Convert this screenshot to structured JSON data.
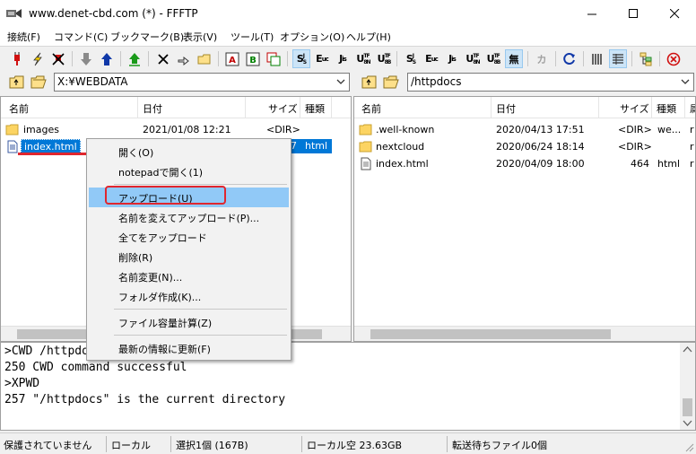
{
  "window": {
    "title": "www.denet-cbd.com (*) - FFFTP"
  },
  "menu": [
    "接続(F)",
    "コマンド(C)",
    "ブックマーク(B)",
    "表示(V)",
    "ツール(T)",
    "オプション(O)",
    "ヘルプ(H)"
  ],
  "toolbar": {
    "kanji_s": "S",
    "kanji_e": "E",
    "kanji_j": "J",
    "kanji_u": "U",
    "kanji_u8": "U",
    "nocvt": "無",
    "kana": "カ"
  },
  "local": {
    "path": "X:¥WEBDATA",
    "headers": {
      "name": "名前",
      "date": "日付",
      "size": "サイズ",
      "type": "種類"
    },
    "files": [
      {
        "name": "images",
        "date": "2021/01/08 12:21",
        "size": "<DIR>",
        "type": ""
      },
      {
        "name": "index.html",
        "date": "",
        "size": "7",
        "type": "html"
      }
    ]
  },
  "remote": {
    "path": "/httpdocs",
    "headers": {
      "name": "名前",
      "date": "日付",
      "size": "サイズ",
      "type": "種類",
      "perm": "属"
    },
    "files": [
      {
        "name": ".well-known",
        "date": "2020/04/13 17:51",
        "size": "<DIR>",
        "type": "we...",
        "perm": "r"
      },
      {
        "name": "nextcloud",
        "date": "2020/06/24 18:14",
        "size": "<DIR>",
        "type": "",
        "perm": "r"
      },
      {
        "name": "index.html",
        "date": "2020/04/09 18:00",
        "size": "464",
        "type": "html",
        "perm": "r"
      }
    ]
  },
  "context_menu": [
    "開く(O)",
    "notepadで開く(1)",
    "アップロード(U)",
    "名前を変えてアップロード(P)...",
    "全てをアップロード",
    "削除(R)",
    "名前変更(N)...",
    "フォルダ作成(K)...",
    "ファイル容量計算(Z)",
    "最新の情報に更新(F)"
  ],
  "log": [
    ">CWD /httpdocs",
    "250 CWD command successful",
    ">XPWD",
    "257 \"/httpdocs\" is the current directory"
  ],
  "status": {
    "encryption": "保護されていません",
    "mode": "ローカル",
    "selection": "選択1個 (167B)",
    "free": "ローカル空 23.63GB",
    "queue": "転送待ちファイル0個"
  },
  "colors": {
    "highlight": "#91c9f7",
    "selection": "#0078d7",
    "annotation": "#e0262e"
  }
}
